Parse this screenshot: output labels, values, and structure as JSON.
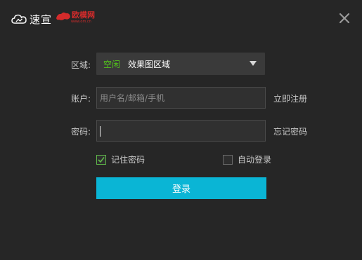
{
  "titlebar": {
    "brand_text": "速宣",
    "watermark_text": "欧模网",
    "watermark_url": "www.om.cn",
    "close_icon": "close-icon"
  },
  "form": {
    "region": {
      "label": "区域:",
      "status": "空闲",
      "value": "效果图区域",
      "arrow_icon": "chevron-down-icon"
    },
    "account": {
      "label": "账户:",
      "placeholder": "用户名/邮箱/手机",
      "value": "",
      "link": "立即注册"
    },
    "password": {
      "label": "密码:",
      "value": "",
      "link": "忘记密码"
    },
    "remember": {
      "label": "记住密码",
      "checked": true
    },
    "auto_login": {
      "label": "自动登录",
      "checked": false
    },
    "submit_label": "登录"
  },
  "colors": {
    "background": "#262626",
    "accent": "#0ab5d5",
    "status_green": "#52c41a",
    "watermark_red": "#d42b2b"
  }
}
